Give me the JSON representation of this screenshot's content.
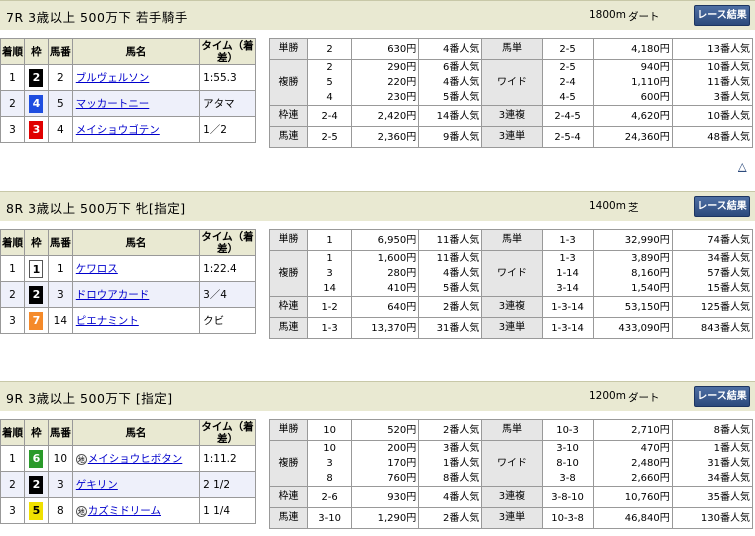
{
  "races": [
    {
      "title": "7R 3歳以上 500万下 若手騎手",
      "distance": "1800m",
      "surface": "ダート",
      "button": "レース結果",
      "headers": [
        "着順",
        "枠",
        "馬番",
        "馬名",
        "タイム（着差）"
      ],
      "rows": [
        {
          "pos": "1",
          "waku": "2",
          "num": "2",
          "name": "ブルヴェルソン",
          "time": "1:55.3",
          "bg": "#000",
          "fg": "#fff",
          "chiho": false
        },
        {
          "pos": "2",
          "waku": "4",
          "num": "5",
          "name": "マッカートニー",
          "time": "アタマ",
          "bg": "#1f4ee0",
          "fg": "#fff",
          "chiho": false
        },
        {
          "pos": "3",
          "waku": "3",
          "num": "4",
          "name": "メイショウゴテン",
          "time": "1／2",
          "bg": "#e00000",
          "fg": "#fff",
          "chiho": false
        }
      ],
      "payouts": {
        "tansho": {
          "label": "単勝",
          "combos": [
            "2"
          ],
          "amounts": [
            "630円"
          ],
          "ninki": [
            "4番人気"
          ]
        },
        "fukusho": {
          "label": "複勝",
          "combos": [
            "2",
            "5",
            "4"
          ],
          "amounts": [
            "290円",
            "220円",
            "230円"
          ],
          "ninki": [
            "6番人気",
            "4番人気",
            "5番人気"
          ]
        },
        "wakuren": {
          "label": "枠連",
          "combos": [
            "2-4"
          ],
          "amounts": [
            "2,420円"
          ],
          "ninki": [
            "14番人気"
          ]
        },
        "umaren": {
          "label": "馬連",
          "combos": [
            "2-5"
          ],
          "amounts": [
            "2,360円"
          ],
          "ninki": [
            "9番人気"
          ]
        },
        "umatan": {
          "label": "馬単",
          "combos": [
            "2-5"
          ],
          "amounts": [
            "4,180円"
          ],
          "ninki": [
            "13番人気"
          ]
        },
        "wide": {
          "label": "ワイド",
          "combos": [
            "2-5",
            "2-4",
            "4-5"
          ],
          "amounts": [
            "940円",
            "1,110円",
            "600円"
          ],
          "ninki": [
            "10番人気",
            "11番人気",
            "3番人気"
          ]
        },
        "sanrenpuku": {
          "label": "3連複",
          "combos": [
            "2-4-5"
          ],
          "amounts": [
            "4,620円"
          ],
          "ninki": [
            "10番人気"
          ]
        },
        "sanrentan": {
          "label": "3連単",
          "combos": [
            "2-5-4"
          ],
          "amounts": [
            "24,360円"
          ],
          "ninki": [
            "48番人気"
          ]
        }
      },
      "up_arrow": "△"
    },
    {
      "title": "8R 3歳以上 500万下 牝[指定]",
      "distance": "1400m",
      "surface": "芝",
      "button": "レース結果",
      "headers": [
        "着順",
        "枠",
        "馬番",
        "馬名",
        "タイム（着差）"
      ],
      "rows": [
        {
          "pos": "1",
          "waku": "1",
          "num": "1",
          "name": "ケワロス",
          "time": "1:22.4",
          "bg": "#fff",
          "fg": "#000",
          "chiho": false
        },
        {
          "pos": "2",
          "waku": "2",
          "num": "3",
          "name": "ドロウアカード",
          "time": "3／4",
          "bg": "#000",
          "fg": "#fff",
          "chiho": false
        },
        {
          "pos": "3",
          "waku": "7",
          "num": "14",
          "name": "ピエナミント",
          "time": "クビ",
          "bg": "#f58a2a",
          "fg": "#fff",
          "chiho": false
        }
      ],
      "payouts": {
        "tansho": {
          "label": "単勝",
          "combos": [
            "1"
          ],
          "amounts": [
            "6,950円"
          ],
          "ninki": [
            "11番人気"
          ]
        },
        "fukusho": {
          "label": "複勝",
          "combos": [
            "1",
            "3",
            "14"
          ],
          "amounts": [
            "1,600円",
            "280円",
            "410円"
          ],
          "ninki": [
            "11番人気",
            "4番人気",
            "5番人気"
          ]
        },
        "wakuren": {
          "label": "枠連",
          "combos": [
            "1-2"
          ],
          "amounts": [
            "640円"
          ],
          "ninki": [
            "2番人気"
          ]
        },
        "umaren": {
          "label": "馬連",
          "combos": [
            "1-3"
          ],
          "amounts": [
            "13,370円"
          ],
          "ninki": [
            "31番人気"
          ]
        },
        "umatan": {
          "label": "馬単",
          "combos": [
            "1-3"
          ],
          "amounts": [
            "32,990円"
          ],
          "ninki": [
            "74番人気"
          ]
        },
        "wide": {
          "label": "ワイド",
          "combos": [
            "1-3",
            "1-14",
            "3-14"
          ],
          "amounts": [
            "3,890円",
            "8,160円",
            "1,540円"
          ],
          "ninki": [
            "34番人気",
            "57番人気",
            "15番人気"
          ]
        },
        "sanrenpuku": {
          "label": "3連複",
          "combos": [
            "1-3-14"
          ],
          "amounts": [
            "53,150円"
          ],
          "ninki": [
            "125番人気"
          ]
        },
        "sanrentan": {
          "label": "3連単",
          "combos": [
            "1-3-14"
          ],
          "amounts": [
            "433,090円"
          ],
          "ninki": [
            "843番人気"
          ]
        }
      }
    },
    {
      "title": "9R 3歳以上 500万下 [指定]",
      "distance": "1200m",
      "surface": "ダート",
      "button": "レース結果",
      "headers": [
        "着順",
        "枠",
        "馬番",
        "馬名",
        "タイム（着差）"
      ],
      "rows": [
        {
          "pos": "1",
          "waku": "6",
          "num": "10",
          "name": "メイショウヒボタン",
          "time": "1:11.2",
          "bg": "#2a9a2a",
          "fg": "#fff",
          "chiho": true
        },
        {
          "pos": "2",
          "waku": "2",
          "num": "3",
          "name": "ゲキリン",
          "time": "2 1/2",
          "bg": "#000",
          "fg": "#fff",
          "chiho": false
        },
        {
          "pos": "3",
          "waku": "5",
          "num": "8",
          "name": "カズミドリーム",
          "time": "1 1/4",
          "bg": "#f0e000",
          "fg": "#000",
          "chiho": true
        }
      ],
      "payouts": {
        "tansho": {
          "label": "単勝",
          "combos": [
            "10"
          ],
          "amounts": [
            "520円"
          ],
          "ninki": [
            "2番人気"
          ]
        },
        "fukusho": {
          "label": "複勝",
          "combos": [
            "10",
            "3",
            "8"
          ],
          "amounts": [
            "200円",
            "170円",
            "760円"
          ],
          "ninki": [
            "3番人気",
            "1番人気",
            "8番人気"
          ]
        },
        "wakuren": {
          "label": "枠連",
          "combos": [
            "2-6"
          ],
          "amounts": [
            "930円"
          ],
          "ninki": [
            "4番人気"
          ]
        },
        "umaren": {
          "label": "馬連",
          "combos": [
            "3-10"
          ],
          "amounts": [
            "1,290円"
          ],
          "ninki": [
            "2番人気"
          ]
        },
        "umatan": {
          "label": "馬単",
          "combos": [
            "10-3"
          ],
          "amounts": [
            "2,710円"
          ],
          "ninki": [
            "8番人気"
          ]
        },
        "wide": {
          "label": "ワイド",
          "combos": [
            "3-10",
            "8-10",
            "3-8"
          ],
          "amounts": [
            "470円",
            "2,480円",
            "2,660円"
          ],
          "ninki": [
            "1番人気",
            "31番人気",
            "34番人気"
          ]
        },
        "sanrenpuku": {
          "label": "3連複",
          "combos": [
            "3-8-10"
          ],
          "amounts": [
            "10,760円"
          ],
          "ninki": [
            "35番人気"
          ]
        },
        "sanrentan": {
          "label": "3連単",
          "combos": [
            "10-3-8"
          ],
          "amounts": [
            "46,840円"
          ],
          "ninki": [
            "130番人気"
          ]
        }
      }
    }
  ],
  "chiho_badge": "地"
}
